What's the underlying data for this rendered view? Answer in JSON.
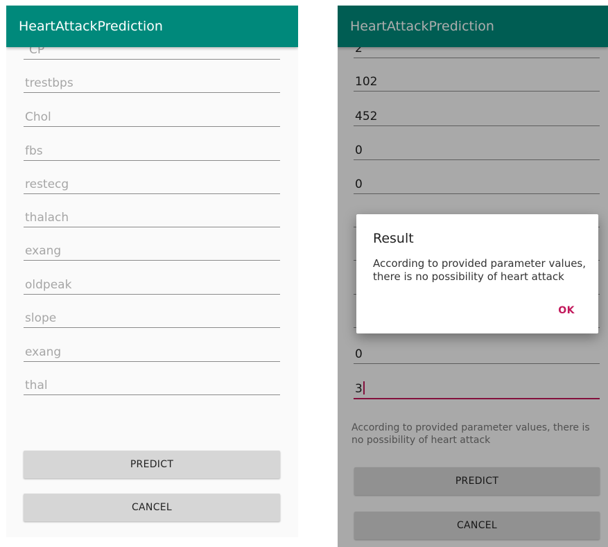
{
  "app": {
    "title": "HeartAttackPrediction"
  },
  "left_screen": {
    "fields": [
      {
        "hint": "CP"
      },
      {
        "hint": "trestbps"
      },
      {
        "hint": "Chol"
      },
      {
        "hint": "fbs"
      },
      {
        "hint": "restecg"
      },
      {
        "hint": "thalach"
      },
      {
        "hint": "exang"
      },
      {
        "hint": "oldpeak"
      },
      {
        "hint": "slope"
      },
      {
        "hint": "exang"
      },
      {
        "hint": "thal"
      }
    ],
    "predict_label": "PREDICT",
    "cancel_label": "CANCEL"
  },
  "right_screen": {
    "fields": [
      {
        "value": "2"
      },
      {
        "value": "102"
      },
      {
        "value": "452"
      },
      {
        "value": "0"
      },
      {
        "value": "0"
      },
      {
        "value": ""
      },
      {
        "value": ""
      },
      {
        "value": ""
      },
      {
        "value": ""
      },
      {
        "value": "0"
      },
      {
        "value": "3",
        "focused": true
      }
    ],
    "result_text": "According to provided parameter values, there is no possibility of heart attack",
    "predict_label": "PREDICT",
    "cancel_label": "CANCEL",
    "dialog": {
      "title": "Result",
      "message": "According to provided parameter values, there is no possibility of heart attack",
      "ok_label": "OK"
    }
  },
  "colors": {
    "appbar": "#00897b",
    "accent": "#c2185b",
    "hint_text": "#a6a6a6",
    "button_bg": "#d6d6d6"
  }
}
